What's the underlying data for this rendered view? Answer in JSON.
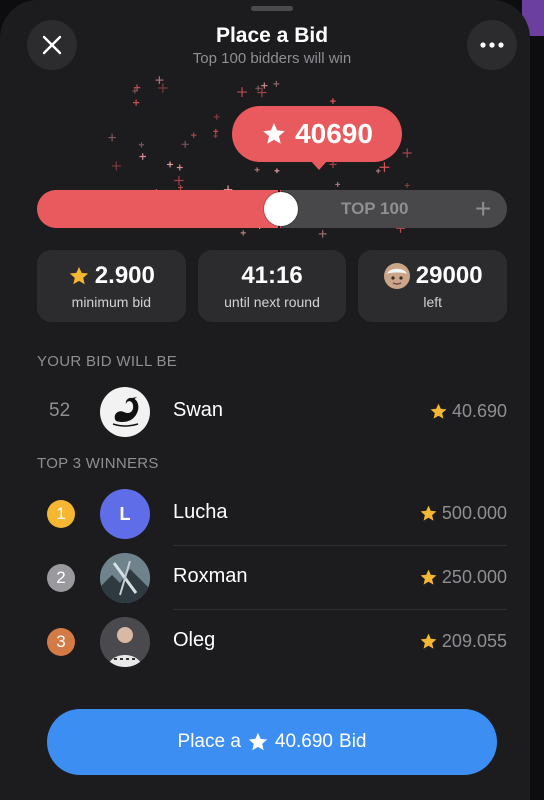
{
  "header": {
    "title": "Place a Bid",
    "subtitle": "Top 100 bidders will win"
  },
  "bid": {
    "current_value": "40690",
    "slider_label": "TOP 100",
    "slider_fraction": 0.52
  },
  "stats": [
    {
      "value": "2.900",
      "label": "minimum bid",
      "icon": "star-icon"
    },
    {
      "value": "41:16",
      "label": "until next round",
      "icon": ""
    },
    {
      "value": "29000",
      "label": "left",
      "icon": "gift-icon"
    }
  ],
  "your_bid": {
    "heading": "YOUR BID WILL BE",
    "rank": "52",
    "name": "Swan",
    "amount": "40.690"
  },
  "winners": {
    "heading": "TOP 3 WINNERS",
    "items": [
      {
        "rank": "1",
        "name": "Lucha",
        "amount": "500.000",
        "avatar_letter": "L",
        "medal_color": "#f5b731",
        "avatar_color": "#5f6de8"
      },
      {
        "rank": "2",
        "name": "Roxman",
        "amount": "250.000",
        "avatar_letter": "",
        "medal_color": "#9a9a9e",
        "avatar_color": "#5b6f78"
      },
      {
        "rank": "3",
        "name": "Oleg",
        "amount": "209.055",
        "avatar_letter": "",
        "medal_color": "#d27b45",
        "avatar_color": "#3b3b3f"
      }
    ]
  },
  "cta": {
    "prefix": "Place a",
    "amount": "40.690",
    "suffix": "Bid"
  },
  "colors": {
    "accent_red": "#e85a5e",
    "button_blue": "#3d8ef2",
    "star_gold": "#f5b731"
  }
}
